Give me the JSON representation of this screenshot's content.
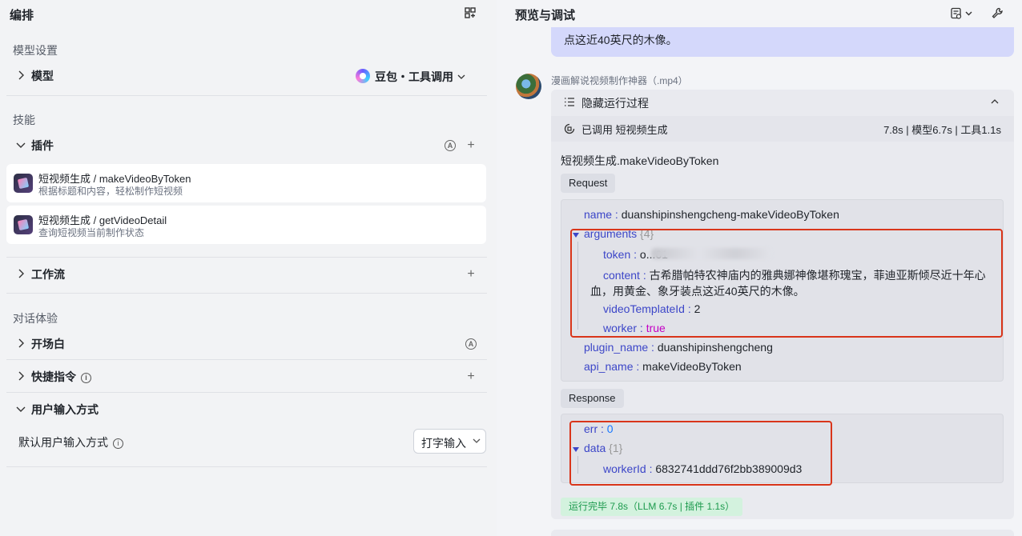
{
  "left": {
    "title": "编排",
    "model_section": "模型设置",
    "model_row": "模型",
    "model_name": "豆包・工具调用",
    "skills_section": "技能",
    "plugins_row": "插件",
    "plugins": [
      {
        "name": "短视频生成 / makeVideoByToken",
        "desc": "根据标题和内容，轻松制作短视频"
      },
      {
        "name": "短视频生成 / getVideoDetail",
        "desc": "查询短视频当前制作状态"
      }
    ],
    "workflow_row": "工作流",
    "dialog_section": "对话体验",
    "opening_row": "开场白",
    "shortcut_row": "快捷指令",
    "user_input_row": "用户输入方式",
    "default_input_label": "默认用户输入方式",
    "default_input_value": "打字输入"
  },
  "right": {
    "title": "预览与调试",
    "user_message_tail": "点这近40英尺的木像。",
    "bot_name": "漫画解说视频制作神器（.mp4）",
    "hide_process": "隐藏运行过程",
    "called_label": "已调用 短视频生成",
    "timing": "7.8s | 模型6.7s | 工具1.1s",
    "call_title": "短视频生成.makeVideoByToken",
    "request_tag": "Request",
    "response_tag": "Response",
    "request": {
      "name_key": "name",
      "name_val": "duanshipinshengcheng-makeVideoByToken",
      "args_key": "arguments",
      "args_count": "{4}",
      "token_key": "token",
      "token_val": "o...61",
      "content_key": "content",
      "content_line1": "古希腊帕特农神庙内的雅典娜神像堪称瑰宝，菲迪亚斯倾尽近十年心",
      "content_line2": "血，用黄金、象牙装点这近40英尺的木像。",
      "tpl_key": "videoTemplateId",
      "tpl_val": "2",
      "worker_key": "worker",
      "worker_val": "true",
      "plugin_key": "plugin_name",
      "plugin_val": "duanshipinshengcheng",
      "api_key": "api_name",
      "api_val": "makeVideoByToken"
    },
    "response": {
      "err_key": "err",
      "err_val": "0",
      "data_key": "data",
      "data_count": "{1}",
      "worker_id_key": "workerId",
      "worker_id_val": "6832741ddd76f2bb389009d3"
    },
    "status": "运行完毕 7.8s（LLM 6.7s | 插件 1.1s）"
  }
}
